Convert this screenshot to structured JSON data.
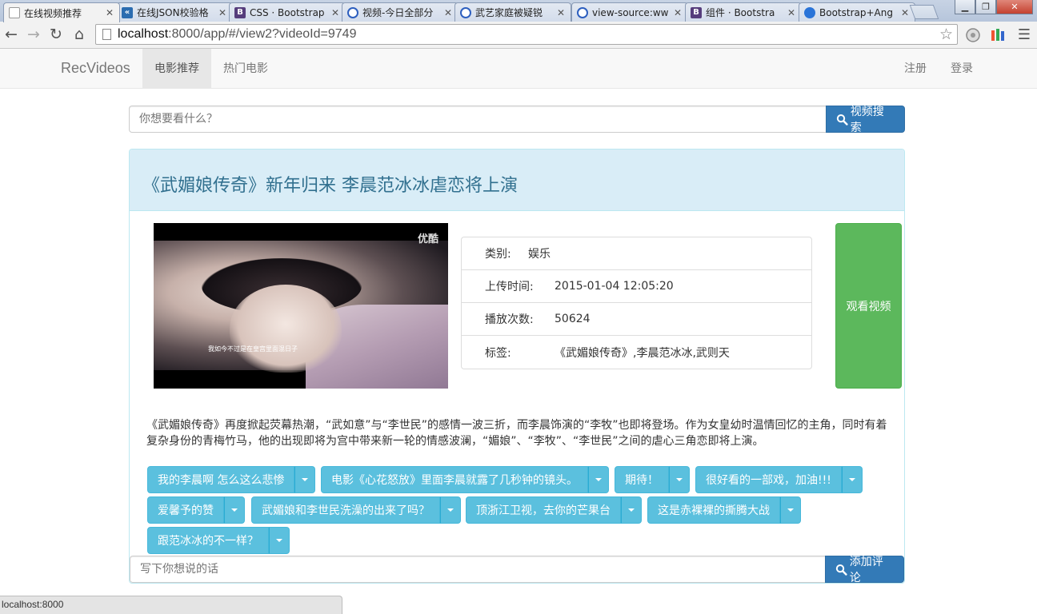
{
  "browser": {
    "tabs": [
      {
        "title": "在线视频推荐",
        "icon": "doc"
      },
      {
        "title": "在线JSON校验格",
        "icon": "json"
      },
      {
        "title": "CSS · Bootstrap",
        "icon": "bootstrap"
      },
      {
        "title": "视频-今日全部分",
        "icon": "play"
      },
      {
        "title": "武艺家庭被疑锐",
        "icon": "play"
      },
      {
        "title": "view-source:ww",
        "icon": "play"
      },
      {
        "title": "组件 · Bootstra",
        "icon": "bootstrap"
      },
      {
        "title": "Bootstrap+Ang",
        "icon": "ng"
      }
    ],
    "url_host": "localhost",
    "url_rest": ":8000/app/#/view2?videoId=9749",
    "status_text": "localhost:8000"
  },
  "nav": {
    "brand": "RecVideos",
    "links": [
      "电影推荐",
      "热门电影"
    ],
    "right_links": [
      "注册",
      "登录"
    ]
  },
  "search": {
    "placeholder": "你想要看什么？",
    "button": "视频搜索"
  },
  "video": {
    "title": "《武媚娘传奇》新年归来 李晨范冰冰虐恋将上演",
    "thumb_logo": "优酷",
    "thumb_caption": "我如今不过是在皇宫里面混日子",
    "info": [
      {
        "label": "类别:",
        "value": "娱乐"
      },
      {
        "label": "上传时间:",
        "value": "2015-01-04 12:05:20"
      },
      {
        "label": "播放次数:",
        "value": "50624"
      },
      {
        "label": "标签:",
        "value": "《武媚娘传奇》,李晨范冰冰,武则天"
      }
    ],
    "watch_button": "观看视频",
    "description": "《武媚娘传奇》再度掀起荧幕热潮，“武如意”与“李世民”的感情一波三折，而李晨饰演的“李牧”也即将登场。作为女皇幼时温情回忆的主角，同时有着复杂身份的青梅竹马，他的出现即将为宫中带来新一轮的情感波澜，“媚娘”、“李牧”、“李世民”之间的虐心三角恋即将上演。"
  },
  "comments": [
    "我的李晨啊 怎么这么悲惨",
    "电影《心花怒放》里面李晨就露了几秒钟的镜头。",
    "期待！",
    "很好看的一部戏，加油!!!",
    "爱馨予的赞",
    "武媚娘和李世民洗澡的出来了吗？",
    "顶浙江卫视，去你的芒果台",
    "这是赤裸裸的撕腾大战",
    "跟范冰冰的不一样？"
  ],
  "comment_form": {
    "placeholder": "写下你想说的话",
    "button": "添加评论"
  },
  "colors": {
    "primary": "#337ab7",
    "info": "#5bc0de",
    "success": "#5cb85c",
    "panel_heading": "#d9edf7",
    "panel_title": "#31708f"
  }
}
